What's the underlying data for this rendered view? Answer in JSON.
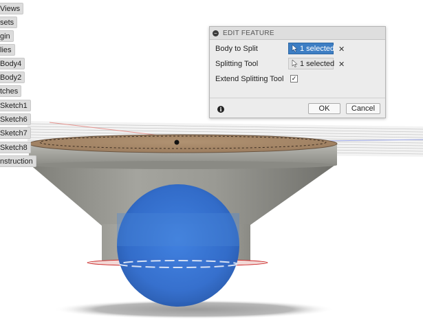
{
  "browser_tree": {
    "items": [
      {
        "label": "Views"
      },
      {
        "label": "sets"
      },
      {
        "label": "gin"
      },
      {
        "label": "lies"
      },
      {
        "label": "Body4"
      },
      {
        "label": "Body2"
      },
      {
        "label": "tches"
      },
      {
        "label": "Sketch1"
      },
      {
        "label": "Sketch6"
      },
      {
        "label": "Sketch7"
      },
      {
        "label": "Sketch8"
      },
      {
        "label": "nstruction"
      }
    ]
  },
  "dialog": {
    "title": "EDIT FEATURE",
    "body_to_split_label": "Body to Split",
    "body_to_split_value": "1 selected",
    "splitting_tool_label": "Splitting Tool",
    "splitting_tool_value": "1 selected",
    "extend_label": "Extend Splitting Tool",
    "extend_checked": true,
    "ok_label": "OK",
    "cancel_label": "Cancel",
    "clear_glyph": "✕",
    "check_glyph": "✓",
    "info_glyph": "i",
    "collapse_glyph": "−"
  },
  "colors": {
    "selection_blue": "#3d7ec4",
    "sphere_blue": "#2f6fd0",
    "body_gray": "#8f8f8a",
    "top_face_wood": "#a58668"
  }
}
